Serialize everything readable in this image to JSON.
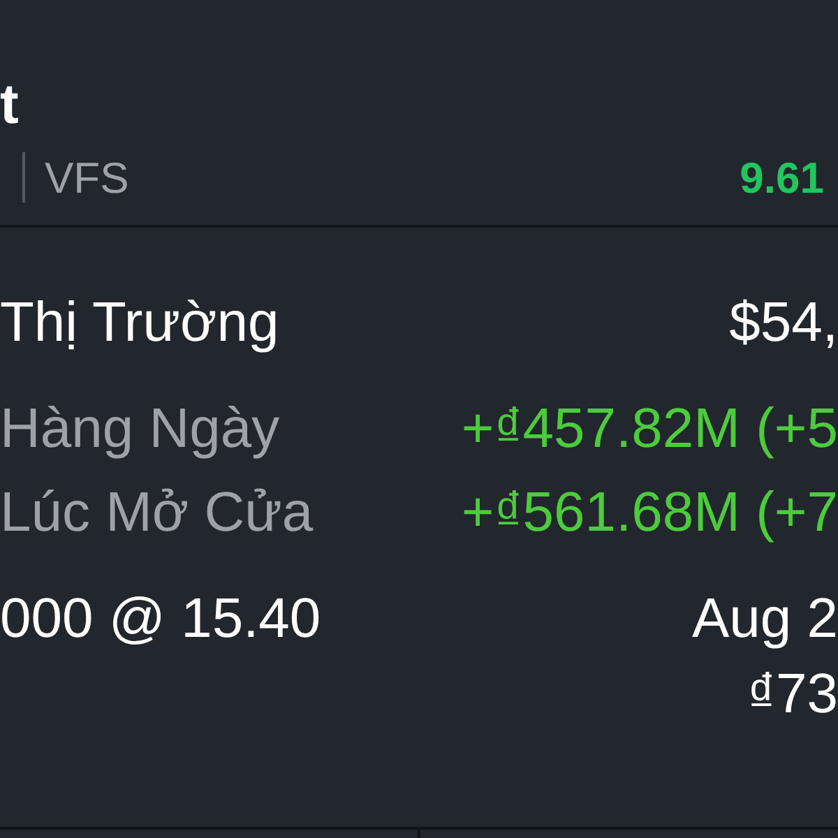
{
  "header": {
    "title": "t",
    "symbol": "VFS",
    "price": "9.61"
  },
  "rows": [
    {
      "label": "Thị Trường",
      "value": "$54,",
      "kind": "plain"
    },
    {
      "label": "Hàng Ngày",
      "value": "+₫457.82M (+5",
      "kind": "change"
    },
    {
      "label": "Lúc Mở Cửa",
      "value": "+₫561.68M (+7",
      "kind": "change"
    },
    {
      "label": "000 @ 15.40",
      "value": "Aug 2",
      "kind": "plain"
    }
  ],
  "extra_value": "₫73"
}
